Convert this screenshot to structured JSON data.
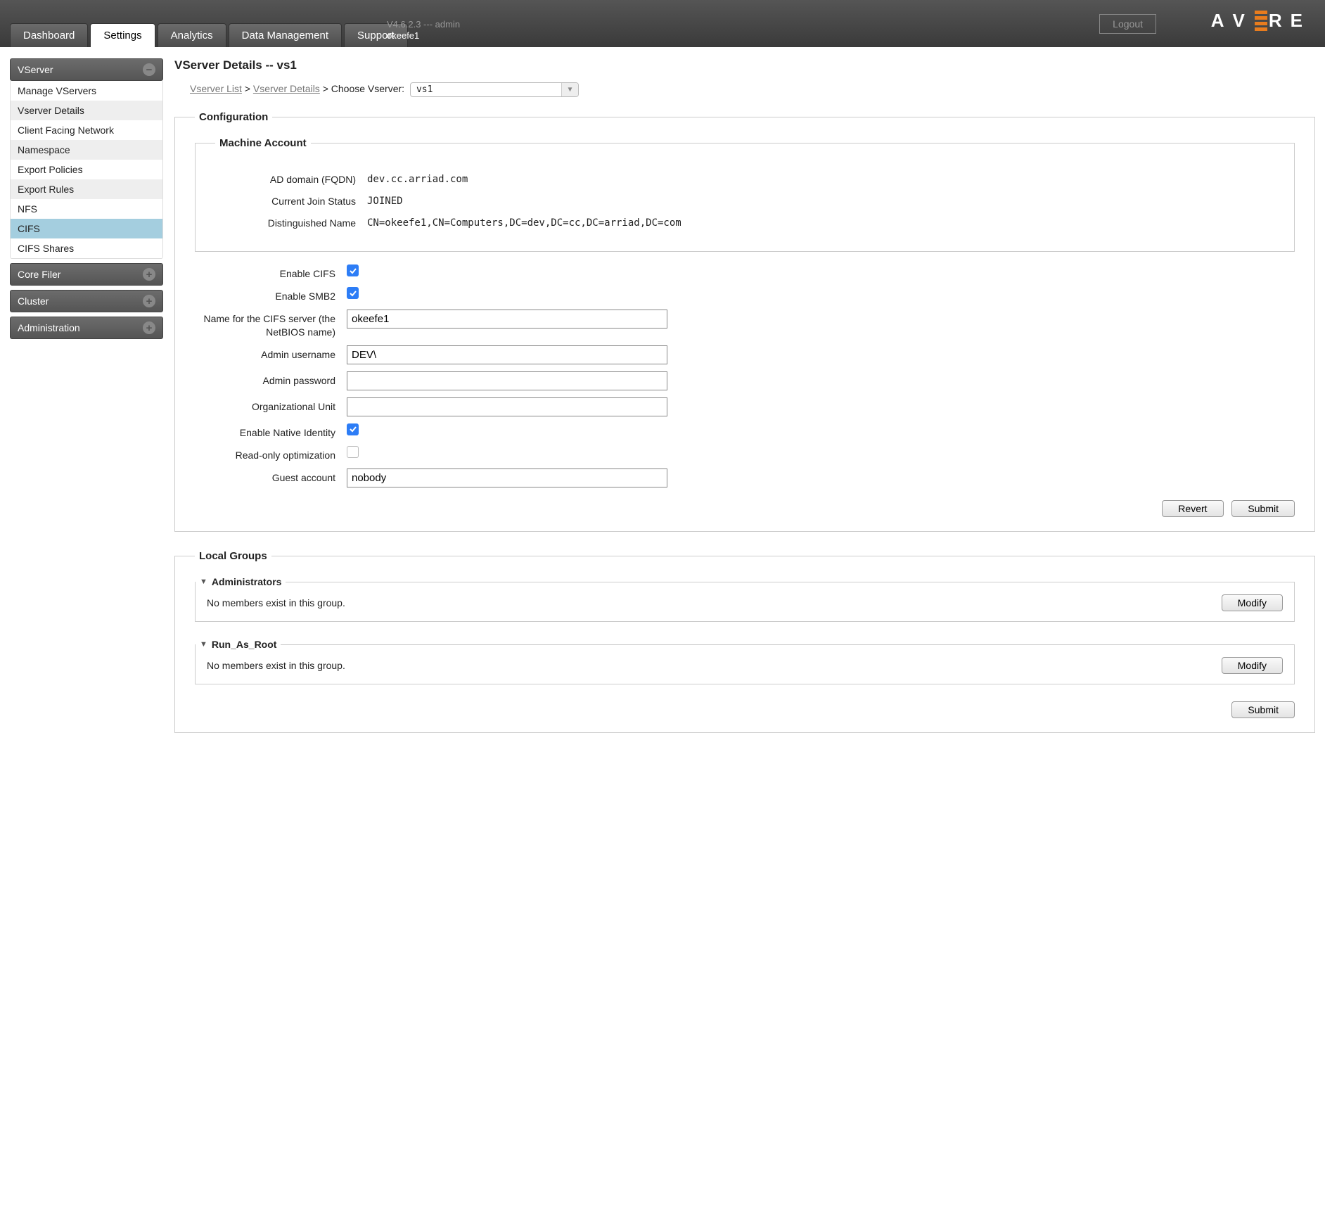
{
  "header": {
    "tabs": [
      "Dashboard",
      "Settings",
      "Analytics",
      "Data Management",
      "Support"
    ],
    "version_line": "V4.6.2.3 --- admin",
    "cluster": "okeefe1",
    "logout": "Logout",
    "logo_letters": [
      "A",
      "V",
      "R",
      "E"
    ]
  },
  "sidebar": {
    "vserver": {
      "title": "VServer",
      "items": [
        "Manage VServers",
        "Vserver Details",
        "Client Facing Network",
        "Namespace",
        "Export Policies",
        "Export Rules",
        "NFS",
        "CIFS",
        "CIFS Shares"
      ]
    },
    "core_filer": "Core Filer",
    "cluster": "Cluster",
    "administration": "Administration"
  },
  "page": {
    "title": "VServer Details -- vs1",
    "breadcrumb": {
      "vserver_list": "Vserver List",
      "vserver_details": "Vserver Details",
      "choose": "Choose Vserver:",
      "selected": "vs1"
    }
  },
  "config": {
    "legend": "Configuration",
    "machine": {
      "legend": "Machine Account",
      "ad_domain_label": "AD domain (FQDN)",
      "ad_domain_value": "dev.cc.arriad.com",
      "join_status_label": "Current Join Status",
      "join_status_value": "JOINED",
      "dn_label": "Distinguished Name",
      "dn_value": "CN=okeefe1,CN=Computers,DC=dev,DC=cc,DC=arriad,DC=com"
    },
    "form": {
      "enable_cifs": "Enable CIFS",
      "enable_smb2": "Enable SMB2",
      "netbios_label": "Name for the CIFS server (the NetBIOS name)",
      "netbios_value": "okeefe1",
      "admin_user_label": "Admin username",
      "admin_user_value": "DEV\\",
      "admin_pass_label": "Admin password",
      "ou_label": "Organizational Unit",
      "native_id_label": "Enable Native Identity",
      "readonly_label": "Read-only optimization",
      "guest_label": "Guest account",
      "guest_value": "nobody",
      "revert": "Revert",
      "submit": "Submit"
    }
  },
  "groups": {
    "legend": "Local Groups",
    "admins": {
      "title": "Administrators",
      "msg": "No members exist in this group.",
      "modify": "Modify"
    },
    "root": {
      "title": "Run_As_Root",
      "msg": "No members exist in this group.",
      "modify": "Modify"
    },
    "submit": "Submit"
  }
}
